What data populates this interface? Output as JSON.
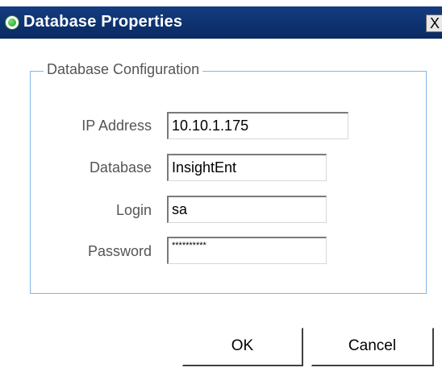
{
  "window": {
    "title": "Database Properties",
    "close_label": "X"
  },
  "group": {
    "legend": "Database Configuration"
  },
  "fields": {
    "ip_address": {
      "label": "IP Address",
      "value": "10.10.1.175"
    },
    "database": {
      "label": "Database",
      "value": "InsightEnt"
    },
    "login": {
      "label": "Login",
      "value": "sa"
    },
    "password": {
      "label": "Password",
      "value": "**********"
    }
  },
  "buttons": {
    "ok": "OK",
    "cancel": "Cancel"
  },
  "colors": {
    "titlebar": "#0a2f6e",
    "group_border": "#7fb6e6",
    "label_text": "#555555"
  },
  "icons": {
    "title_icon": "green-circle-icon"
  }
}
